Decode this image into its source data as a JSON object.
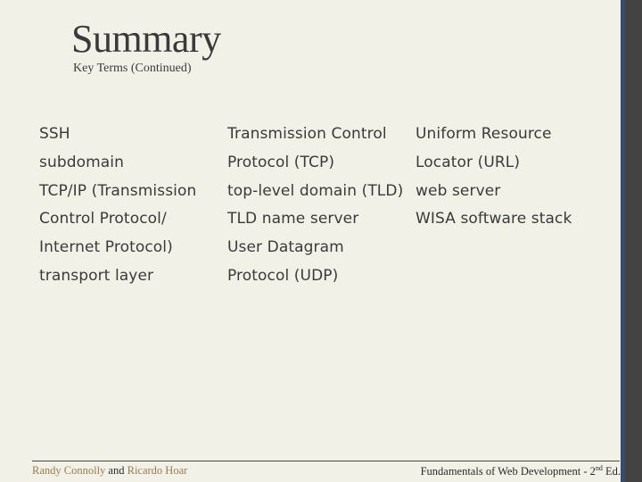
{
  "slide": {
    "title": "Summary",
    "subtitle": "Key Terms (Continued)"
  },
  "columns": [
    {
      "terms": [
        "SSH",
        "subdomain",
        "TCP/IP (Transmission",
        "Control Protocol/",
        "Internet Protocol)",
        "transport layer"
      ]
    },
    {
      "terms": [
        "Transmission Control",
        "Protocol (TCP)",
        "top-level domain (TLD)",
        "TLD name server",
        "User Datagram",
        "Protocol (UDP)"
      ]
    },
    {
      "terms": [
        "Uniform Resource",
        "Locator (URL)",
        "web server",
        "WISA software stack"
      ]
    }
  ],
  "footer": {
    "author1": "Randy Connolly",
    "and": "and",
    "author2": "Ricardo Hoar",
    "book_title": "Fundamentals of Web Development - 2",
    "edition_sup": "nd",
    "edition_suffix": " Ed."
  },
  "colors": {
    "background": "#f2f1e8",
    "text": "#3a3a3a",
    "author_accent": "#9a7c4e",
    "side_band": "#434343",
    "side_stripe": "#34486e"
  }
}
